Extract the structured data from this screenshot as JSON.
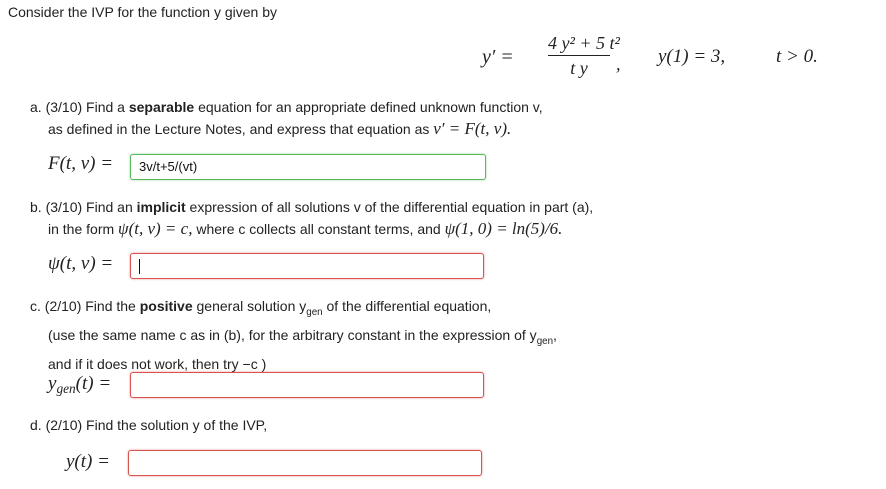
{
  "header": {
    "text": "Consider the IVP for the function y given by"
  },
  "ivp": {
    "lhs": "y′ =",
    "numerator": "4 y² + 5 t²",
    "denominator": "t y",
    "separator": ",",
    "initial_condition": "y(1) = 3,",
    "domain_condition": "t > 0."
  },
  "parts": {
    "a": {
      "prefix": "a.  (3/10) Find a ",
      "bold": "separable",
      "suffix": " equation for an appropriate defined unknown function v,",
      "line2_pre": "as defined in the Lecture Notes, and express that equation as ",
      "line2_math": "v′ = F(t, v).",
      "label": "F(t, v) =",
      "answer": "3v/t+5/(vt)",
      "status": "correct"
    },
    "b": {
      "prefix": "b.  (3/10) Find an ",
      "bold": "implicit",
      "suffix": " expression of all solutions v of the differential equation in part (a),",
      "line2_pre": "in the form ",
      "line2_math1": "ψ(t, v) = c,",
      "line2_mid": " where c collects all constant terms, and ",
      "line2_math2": "ψ(1, 0) = ln(5)/6.",
      "label": "ψ(t, v) =",
      "answer": "",
      "status": "incorrect"
    },
    "c": {
      "prefix": "c.  (2/10) Find the ",
      "bold": "positive",
      "suffix": " general solution y",
      "suffix_sub": "gen",
      "suffix_end": " of the differential equation,",
      "line2": "(use the same name c as in (b), for the arbitrary constant in the expression of y",
      "line2_sub": "gen",
      "line2_end": ",",
      "line3": "and if it does not work, then try −c )",
      "label_main": "y",
      "label_sub": "gen",
      "label_end": "(t) =",
      "answer": "",
      "status": "incorrect"
    },
    "d": {
      "text": "d.  (2/10) Find the solution y of the IVP,",
      "label": "y(t) =",
      "answer": "",
      "status": "incorrect"
    }
  },
  "colors": {
    "correct_border": "#5cb85c",
    "incorrect_border": "#d9534f"
  }
}
